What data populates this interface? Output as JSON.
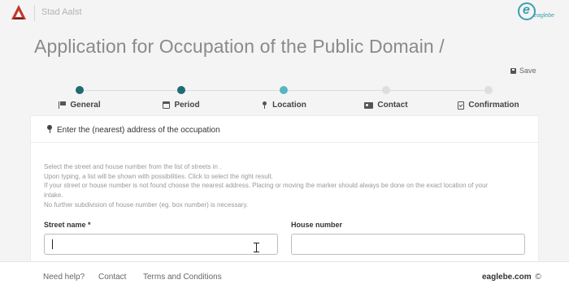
{
  "header": {
    "city": "Stad Aalst",
    "brand_logo_text": "eaglebe",
    "accent_color": "#3aa0ad",
    "logo_color": "#c0392b"
  },
  "page": {
    "title": "Application for Occupation of the Public Domain /",
    "save_label": "Save"
  },
  "stepper": {
    "steps": [
      {
        "label": "General",
        "icon": "flag-icon",
        "state": "done"
      },
      {
        "label": "Period",
        "icon": "calendar-icon",
        "state": "done"
      },
      {
        "label": "Location",
        "icon": "map-pin-icon",
        "state": "active"
      },
      {
        "label": "Contact",
        "icon": "id-card-icon",
        "state": "pending"
      },
      {
        "label": "Confirmation",
        "icon": "clipboard-check-icon",
        "state": "pending"
      }
    ],
    "colors": {
      "done": "#1f6b72",
      "active": "#56b6c2",
      "pending": "#dedede"
    }
  },
  "location": {
    "heading": "Enter the (nearest) address of the occupation",
    "help_lines": [
      "Select the street and house number from the list of streets in .",
      "Upon typing, a list will be shown with possibilities. Click to select the right result.",
      "If your street or house number is not found choose the nearest address. Placing or moving the marker should always be done on the exact location of your",
      "intake.",
      "No further subdivision of house number (eg. box number) is necessary."
    ],
    "street": {
      "label": "Street name *",
      "value": "",
      "placeholder": ""
    },
    "house_number": {
      "label": "House number",
      "value": "",
      "placeholder": ""
    }
  },
  "footer": {
    "help": "Need help?",
    "contact": "Contact",
    "terms": "Terms and Conditions",
    "brand": "eaglebe.com",
    "copyright": "©"
  }
}
